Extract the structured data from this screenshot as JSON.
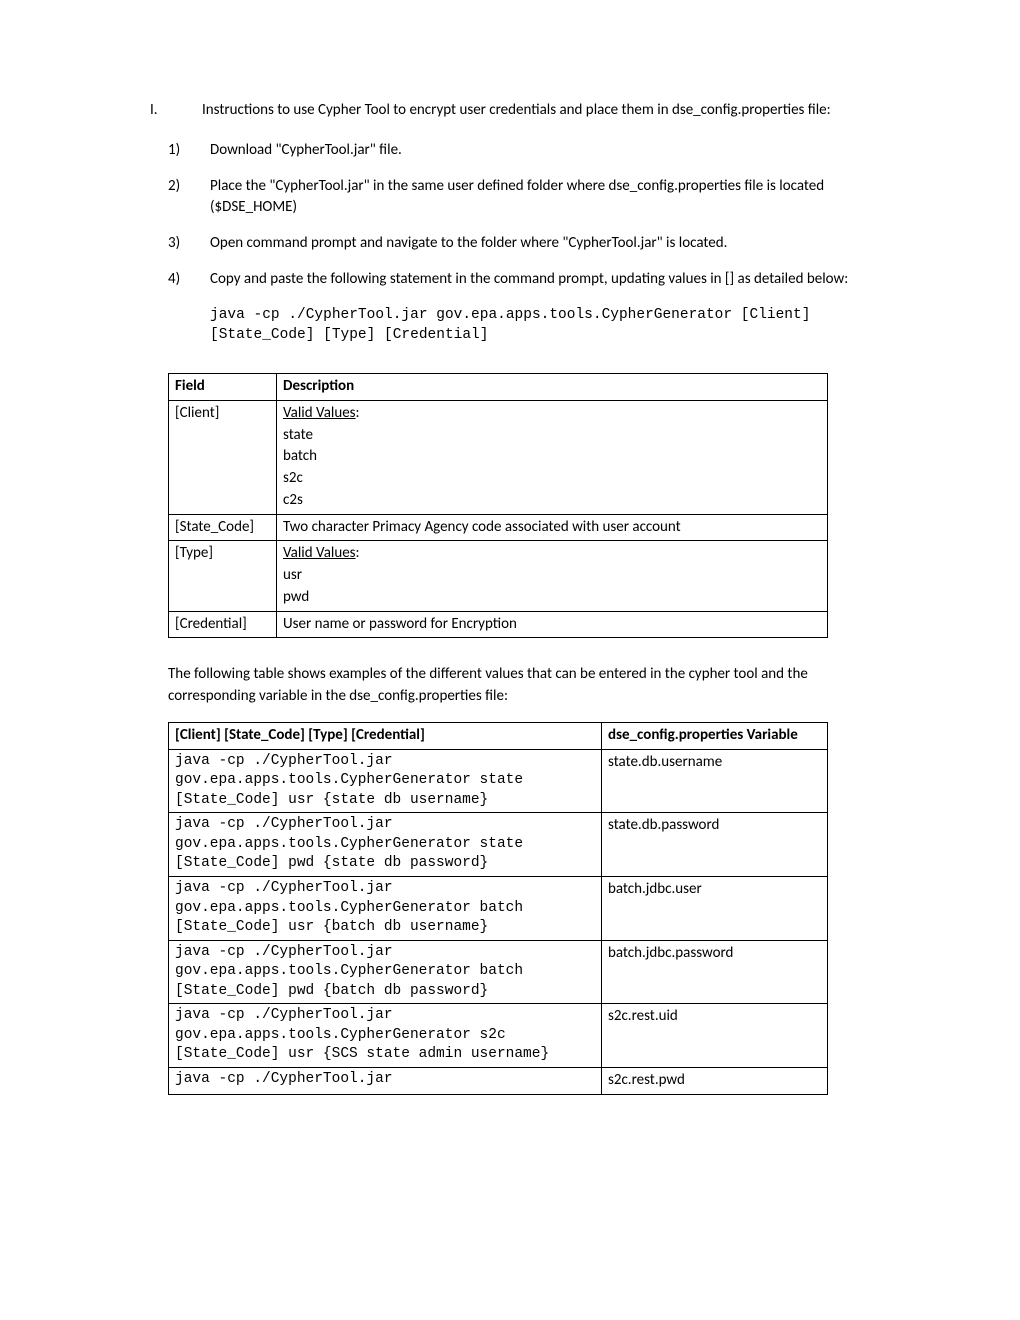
{
  "section": {
    "num": "I.",
    "text": "Instructions to use Cypher Tool to encrypt user credentials and place them in dse_config.properties file:"
  },
  "steps": [
    {
      "num": "1)",
      "text": "Download \"CypherTool.jar\" file."
    },
    {
      "num": "2)",
      "text": "Place the \"CypherTool.jar\" in the same user defined folder where dse_config.properties file is located ($DSE_HOME)"
    },
    {
      "num": "3)",
      "text": "Open command prompt and navigate to the folder where \"CypherTool.jar\" is located."
    },
    {
      "num": "4)",
      "text": "Copy and paste the following statement in the command prompt, updating values in [] as detailed below:"
    }
  ],
  "code_line1": "java -cp ./CypherTool.jar gov.epa.apps.tools.CypherGenerator [Client]",
  "code_line2": "[State_Code] [Type] [Credential]",
  "fields_table": {
    "header": {
      "field": "Field",
      "desc": "Description"
    },
    "valid_label": "Valid Values",
    "rows": {
      "client": {
        "field": "[Client]",
        "values": [
          "state",
          "batch",
          "s2c",
          "c2s"
        ]
      },
      "state_code": {
        "field": "[State_Code]",
        "desc": "Two character Primacy Agency code associated with user account"
      },
      "type": {
        "field": "[Type]",
        "values": [
          "usr",
          "pwd"
        ]
      },
      "credential": {
        "field": "[Credential]",
        "desc": "User name or password for Encryption"
      }
    }
  },
  "intro2": "The following table shows examples of the different values that can be entered in the cypher tool and the corresponding variable in the dse_config.properties file:",
  "examples_table": {
    "header": {
      "cmd": "[Client] [State_Code]    [Type]  [Credential]",
      "var": "dse_config.properties Variable"
    },
    "rows": [
      {
        "l1": "java -cp ./CypherTool.jar",
        "l2": "gov.epa.apps.tools.CypherGenerator state",
        "l3": "[State_Code] usr {state db username}",
        "var": "state.db.username"
      },
      {
        "l1": "java -cp ./CypherTool.jar",
        "l2": "gov.epa.apps.tools.CypherGenerator state",
        "l3": "[State_Code] pwd {state db password}",
        "var": "state.db.password"
      },
      {
        "l1": "java -cp ./CypherTool.jar",
        "l2": "gov.epa.apps.tools.CypherGenerator batch",
        "l3": "[State_Code] usr {batch db username}",
        "var": "batch.jdbc.user"
      },
      {
        "l1": "java -cp ./CypherTool.jar",
        "l2": "gov.epa.apps.tools.CypherGenerator batch",
        "l3": "[State_Code] pwd {batch db password}",
        "var": "batch.jdbc.password"
      },
      {
        "l1": "java -cp ./CypherTool.jar",
        "l2": "gov.epa.apps.tools.CypherGenerator s2c",
        "l3": "[State_Code] usr {SCS state admin username}",
        "var": "s2c.rest.uid"
      },
      {
        "l1": "java -cp ./CypherTool.jar",
        "l2": "",
        "l3": "",
        "var": "s2c.rest.pwd"
      }
    ]
  }
}
